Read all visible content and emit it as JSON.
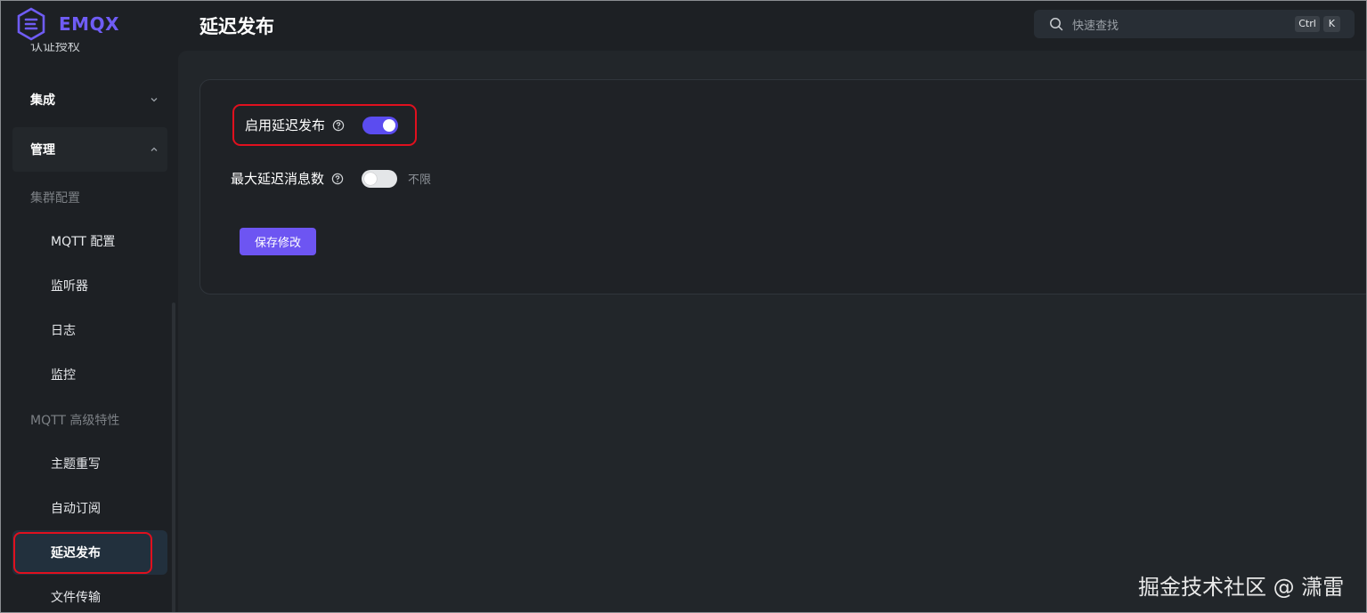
{
  "app": {
    "logo_text": "EMQX"
  },
  "header": {
    "title": "延迟发布"
  },
  "search": {
    "placeholder": "快速查找",
    "key_ctrl": "Ctrl",
    "key_k": "K"
  },
  "sidebar": {
    "cut_item": "认证授权",
    "groups": [
      {
        "label": "集成",
        "expanded": false
      },
      {
        "label": "管理",
        "expanded": true
      }
    ],
    "sections": [
      {
        "label": "集群配置",
        "items": [
          "MQTT 配置",
          "监听器",
          "日志",
          "监控"
        ]
      },
      {
        "label": "MQTT 高级特性",
        "items": [
          "主题重写",
          "自动订阅",
          "延迟发布",
          "文件传输"
        ]
      }
    ],
    "selected_item": "延迟发布"
  },
  "form": {
    "enable_label": "启用延迟发布",
    "enable_value": true,
    "max_label": "最大延迟消息数",
    "max_toggle_value": false,
    "max_toggle_text": "不限",
    "save_label": "保存修改"
  },
  "watermark": "掘金技术社区 @ 潇雷",
  "colors": {
    "accent": "#5b4cf0",
    "highlight": "#e0101e",
    "background": "#1d2024"
  }
}
